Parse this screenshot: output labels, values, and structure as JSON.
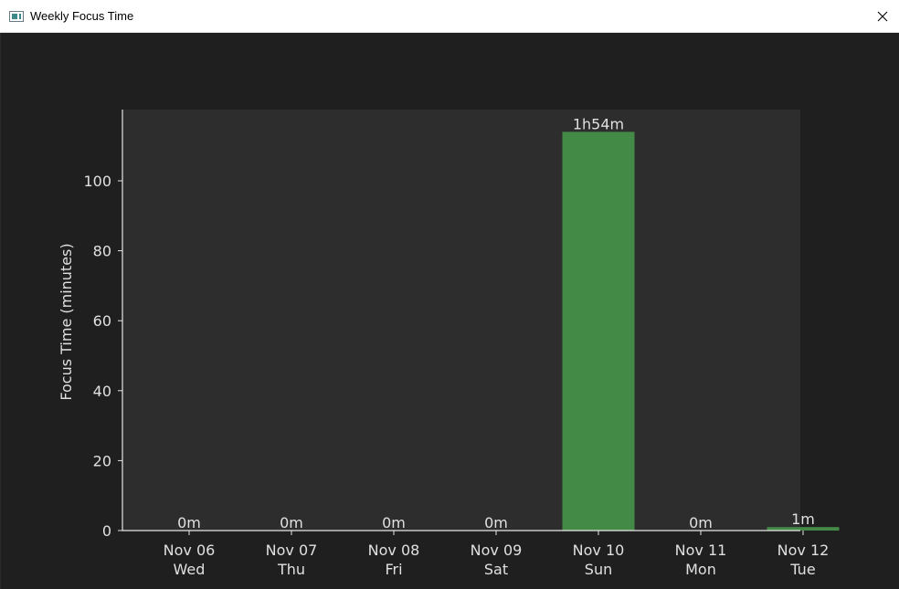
{
  "window": {
    "title": "Weekly Focus Time",
    "icon": "app-window-icon",
    "close_icon": "close-icon"
  },
  "colors": {
    "bar": "#448a47",
    "plot_bg": "#2d2d2d",
    "figure_bg": "#1f1f1f",
    "axis": "#e6e6e6",
    "text": "#e0e0e0"
  },
  "chart_data": {
    "type": "bar",
    "ylabel": "Focus Time (minutes)",
    "xlabel": "",
    "ylim": [
      0,
      120
    ],
    "yticks": [
      0,
      20,
      40,
      60,
      80,
      100
    ],
    "grid": false,
    "categories": [
      "Nov 06",
      "Nov 07",
      "Nov 08",
      "Nov 09",
      "Nov 10",
      "Nov 11",
      "Nov 12"
    ],
    "weekdays": [
      "Wed",
      "Thu",
      "Fri",
      "Sat",
      "Sun",
      "Mon",
      "Tue"
    ],
    "values": [
      0,
      0,
      0,
      0,
      114,
      0,
      1
    ],
    "value_labels": [
      "0m",
      "0m",
      "0m",
      "0m",
      "1h54m",
      "0m",
      "1m"
    ]
  }
}
